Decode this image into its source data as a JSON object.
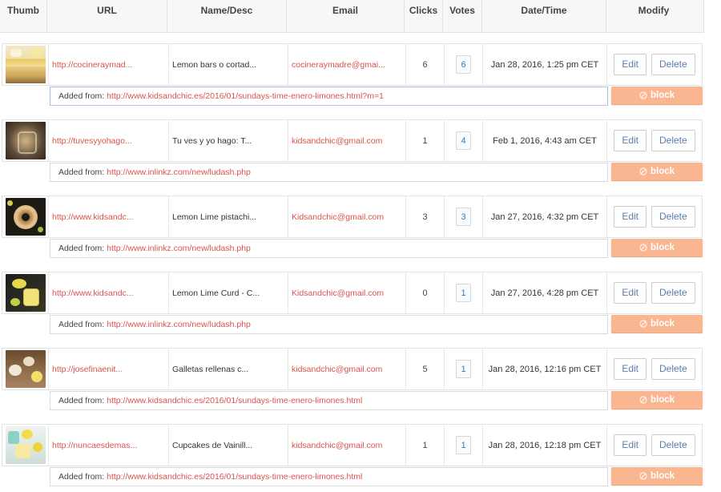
{
  "columns": {
    "thumb": "Thumb",
    "url": "URL",
    "name": "Name/Desc",
    "email": "Email",
    "clicks": "Clicks",
    "votes": "Votes",
    "datetime": "Date/Time",
    "modify": "Modify"
  },
  "labels": {
    "edit": "Edit",
    "delete": "Delete",
    "block": "block",
    "added_from": "Added from:"
  },
  "icons": {
    "block": "ban-icon"
  },
  "colors": {
    "link": "#d9534f",
    "block_button": "#f9b690",
    "vote_text": "#337ab7"
  },
  "rows": [
    {
      "url": "http://cocineraymad...",
      "name": "Lemon bars o cortad...",
      "email": "cocineraymadre@gmai...",
      "clicks": "6",
      "votes": "6",
      "datetime": "Jan 28, 2016, 1:25 pm CET",
      "added_from": "http://www.kidsandchic.es/2016/01/sundays-time-enero-limones.html?m=1",
      "thumb_icon": "lemon-bars-photo"
    },
    {
      "url": "http://tuvesyyohago...",
      "name": "Tu ves y yo hago: T...",
      "email": "kidsandchic@gmail.com",
      "clicks": "1",
      "votes": "4",
      "datetime": "Feb 1, 2016, 4:43 am CET",
      "added_from": "http://www.inlinkz.com/new/ludash.php",
      "thumb_icon": "jar-photo"
    },
    {
      "url": "http://www.kidsandc...",
      "name": "Lemon Lime pistachi...",
      "email": "Kidsandchic@gmail.com",
      "clicks": "3",
      "votes": "3",
      "datetime": "Jan 27, 2016, 4:32 pm CET",
      "added_from": "http://www.inlinkz.com/new/ludash.php",
      "thumb_icon": "bundt-cake-photo"
    },
    {
      "url": "http://www.kidsandc...",
      "name": "Lemon Lime Curd - C...",
      "email": "Kidsandchic@gmail.com",
      "clicks": "0",
      "votes": "1",
      "datetime": "Jan 27, 2016, 4:28 pm CET",
      "added_from": "http://www.inlinkz.com/new/ludash.php",
      "thumb_icon": "lemon-curd-photo"
    },
    {
      "url": "http://josefinaenit...",
      "name": "Galletas rellenas c...",
      "email": "kidsandchic@gmail.com",
      "clicks": "5",
      "votes": "1",
      "datetime": "Jan 28, 2016, 12:16 pm CET",
      "added_from": "http://www.kidsandchic.es/2016/01/sundays-time-enero-limones.html",
      "thumb_icon": "cookies-photo"
    },
    {
      "url": "http://nuncaesdemas...",
      "name": "Cupcakes de Vainill...",
      "email": "kidsandchic@gmail.com",
      "clicks": "1",
      "votes": "1",
      "datetime": "Jan 28, 2016, 12:18 pm CET",
      "added_from": "http://www.kidsandchic.es/2016/01/sundays-time-enero-limones.html",
      "thumb_icon": "cupcakes-photo"
    }
  ]
}
